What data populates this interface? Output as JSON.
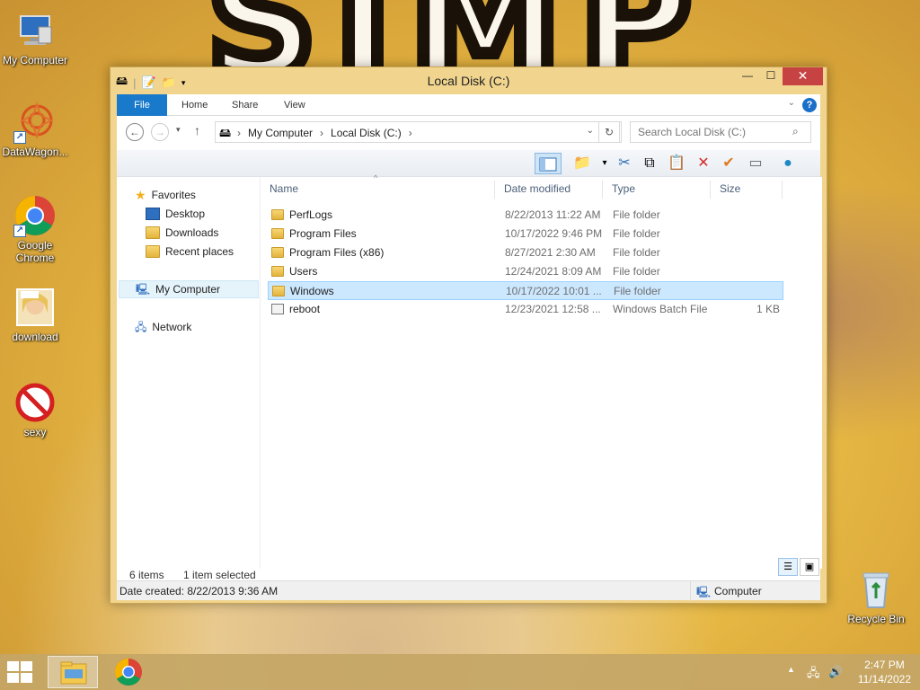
{
  "desktop": {
    "icons": [
      {
        "label": "My Computer",
        "icon": "computer-icon"
      },
      {
        "label": "DataWagon...",
        "icon": "datawagon-icon"
      },
      {
        "label": "Google Chrome",
        "icon": "chrome-icon"
      },
      {
        "label": "download",
        "icon": "image-file-icon"
      },
      {
        "label": "sexy",
        "icon": "no-entry-icon"
      },
      {
        "label": "Recycle Bin",
        "icon": "recycle-bin-icon"
      }
    ],
    "background_text": "SIMP"
  },
  "window": {
    "title": "Local Disk (C:)",
    "minimize": "—",
    "maximize": "☐",
    "close": "✕",
    "ribbon_tabs": [
      "File",
      "Home",
      "Share",
      "View"
    ],
    "help": "?",
    "address": {
      "crumbs": [
        "My Computer",
        "Local Disk (C:)"
      ],
      "search_placeholder": "Search Local Disk (C:)"
    },
    "nav_pane": {
      "favorites": "Favorites",
      "favorites_items": [
        "Desktop",
        "Downloads",
        "Recent places"
      ],
      "my_computer": "My Computer",
      "network": "Network"
    },
    "columns": [
      "Name",
      "Date modified",
      "Type",
      "Size"
    ],
    "files": [
      {
        "name": "PerfLogs",
        "date": "8/22/2013 11:22 AM",
        "type": "File folder",
        "size": "",
        "icon": "folder-icon",
        "selected": false
      },
      {
        "name": "Program Files",
        "date": "10/17/2022 9:46 PM",
        "type": "File folder",
        "size": "",
        "icon": "folder-icon",
        "selected": false
      },
      {
        "name": "Program Files (x86)",
        "date": "8/27/2021 2:30 AM",
        "type": "File folder",
        "size": "",
        "icon": "folder-icon",
        "selected": false
      },
      {
        "name": "Users",
        "date": "12/24/2021 8:09 AM",
        "type": "File folder",
        "size": "",
        "icon": "folder-icon",
        "selected": false
      },
      {
        "name": "Windows",
        "date": "10/17/2022 10:01 ...",
        "type": "File folder",
        "size": "",
        "icon": "folder-icon",
        "selected": true
      },
      {
        "name": "reboot",
        "date": "12/23/2021 12:58 ...",
        "type": "Windows Batch File",
        "size": "1 KB",
        "icon": "batch-file-icon",
        "selected": false
      }
    ],
    "status": {
      "item_count": "6 items",
      "selected": "1 item selected",
      "date_created": "Date created: 8/22/2013 9:36 AM",
      "location": "Computer"
    }
  },
  "taskbar": {
    "time": "2:47 PM",
    "date": "11/14/2022"
  },
  "colors": {
    "accent": "#1979ca",
    "selection": "#cce8ff",
    "close": "#c74343"
  }
}
